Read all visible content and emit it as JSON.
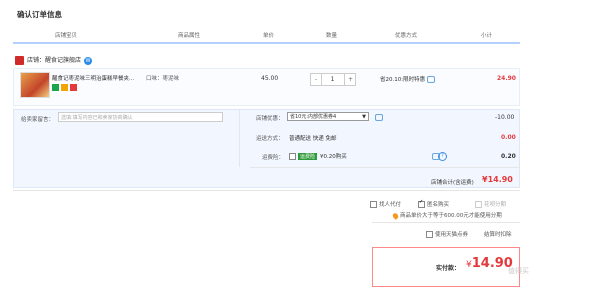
{
  "page_title": "确认订单信息",
  "columns": [
    "店铺宝贝",
    "商品属性",
    "单价",
    "数量",
    "优惠方式",
    "小计"
  ],
  "shop": {
    "label": "店铺：",
    "name": "醒食记旗舰店",
    "ww": "W"
  },
  "item": {
    "title": "醒食记枣泥味三明治蛋糕早餐夹...",
    "attr": "口味：枣泥味",
    "price": "45.00",
    "qty": "1",
    "minus": "-",
    "plus": "+",
    "promo": "省20.10:限时特惠",
    "subtotal": "24.90",
    "badge_colors": [
      "#1aa44b",
      "#f2a400",
      "#e4393c"
    ]
  },
  "message": {
    "label": "给卖家留言：",
    "placeholder": "选填:填写内容已和卖家协商确认"
  },
  "coupon": {
    "label": "店铺优惠：",
    "selected": "省10元:内部优惠券4",
    "value": "-10.00"
  },
  "shipping": {
    "label": "运送方式：",
    "method": "普通配送 快递 免邮",
    "value": "0.00"
  },
  "insurance": {
    "label": "运费险：",
    "tag": "运费险",
    "text": "¥0.20购买",
    "value": "0.20"
  },
  "shop_total": {
    "label": "店铺合计(含运费)",
    "amount": "¥14.90"
  },
  "options": {
    "proxy": "找人代付",
    "anonymous": "匿名购买",
    "installment": "花呗分期"
  },
  "install_note": "商品单价大于等于600.00元才能使用分期",
  "points": {
    "label": "使用天猫点券",
    "value": "结算时扣除"
  },
  "final": {
    "label": "实付款：",
    "symbol": "¥",
    "amount": "14.90"
  },
  "watermark": "值得买"
}
